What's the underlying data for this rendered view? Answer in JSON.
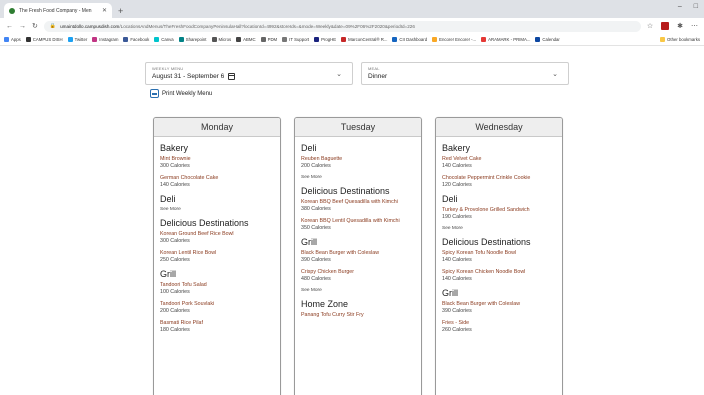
{
  "browser": {
    "tab_title": "The Fresh Food Company - Men",
    "url_host": "umaintdollo.campusdish.com",
    "url_path": "/LocationsAndMenus/TheFreshFoodCompanyPeninsulaHall?locationId=4992&storeIds=&mode=Weekly&date=09%2F06%2F2020&periodId=226",
    "bookmarks": [
      "Apps",
      "CAMPUS DISH",
      "Twitter",
      "Instagram",
      "Facebook",
      "Canva",
      "Sharepoint",
      "Micros",
      "ABMC",
      "PDM",
      "IT Support",
      "ProgHE",
      "MarconCentral® R...",
      "CII Dashboard",
      "Encore! Encore! -...",
      "ARAMARK - PRIMA...",
      "Calendar"
    ],
    "other_bookmarks": "Other bookmarks"
  },
  "filters": {
    "week_label": "WEEKLY MENU",
    "week_value": "August 31 - September 6",
    "meal_label": "MEAL",
    "meal_value": "Dinner",
    "print_label": "Print Weekly Menu"
  },
  "days": [
    {
      "name": "Monday",
      "stations": [
        {
          "name": "Bakery",
          "items": [
            {
              "name": "Mint Brownie",
              "calories": "300 Calories"
            },
            {
              "name": "German Chocolate Cake",
              "calories": "140 Calories"
            }
          ],
          "see_more": ""
        },
        {
          "name": "Deli",
          "items": [],
          "see_more": "See More"
        },
        {
          "name": "Delicious Destinations",
          "items": [
            {
              "name": "Korean Ground Beef Rice Bowl",
              "calories": "300 Calories"
            },
            {
              "name": "Korean Lentil Rice Bowl",
              "calories": "250 Calories"
            }
          ],
          "see_more": ""
        },
        {
          "name": "Grill",
          "items": [
            {
              "name": "Tandoori Tofu Salad",
              "calories": "100 Calories"
            },
            {
              "name": "Tandoori Pork Souvlaki",
              "calories": "200 Calories"
            },
            {
              "name": "Basmati Rice Pilaf",
              "calories": "180 Calories"
            }
          ],
          "see_more": ""
        }
      ]
    },
    {
      "name": "Tuesday",
      "stations": [
        {
          "name": "Deli",
          "items": [
            {
              "name": "Reuben Baguette",
              "calories": "200 Calories"
            }
          ],
          "see_more": "See More"
        },
        {
          "name": "Delicious Destinations",
          "items": [
            {
              "name": "Korean BBQ Beef Quesadilla with Kimchi",
              "calories": "380 Calories"
            },
            {
              "name": "Korean BBQ Lentil Quesadilla with Kimchi",
              "calories": "350 Calories"
            }
          ],
          "see_more": ""
        },
        {
          "name": "Grill",
          "items": [
            {
              "name": "Black Bean Burger with Coleslaw",
              "calories": "390 Calories"
            },
            {
              "name": "Crispy Chicken Burger",
              "calories": "480 Calories"
            }
          ],
          "see_more": "See More"
        },
        {
          "name": "Home Zone",
          "items": [
            {
              "name": "Panang Tofu Curry Stir Fry",
              "calories": ""
            }
          ],
          "see_more": ""
        }
      ]
    },
    {
      "name": "Wednesday",
      "stations": [
        {
          "name": "Bakery",
          "items": [
            {
              "name": "Red Velvet Cake",
              "calories": "140 Calories"
            },
            {
              "name": "Chocolate Peppermint Crinkle Cookie",
              "calories": "120 Calories"
            }
          ],
          "see_more": ""
        },
        {
          "name": "Deli",
          "items": [
            {
              "name": "Turkey & Provolone Grilled Sandwich",
              "calories": "190 Calories"
            }
          ],
          "see_more": "See More"
        },
        {
          "name": "Delicious Destinations",
          "items": [
            {
              "name": "Spicy Korean Tofu Noodle Bowl",
              "calories": "140 Calories"
            },
            {
              "name": "Spicy Korean Chicken Noodle Bowl",
              "calories": "140 Calories"
            }
          ],
          "see_more": ""
        },
        {
          "name": "Grill",
          "items": [
            {
              "name": "Black Bean Burger with Coleslaw",
              "calories": "390 Calories"
            },
            {
              "name": "Fries - Side",
              "calories": "260 Calories"
            }
          ],
          "see_more": ""
        }
      ]
    }
  ],
  "colors": {
    "item_name": "#8a3a1e",
    "header_bg": "#eeeeee",
    "card_border": "#9a9a9a"
  }
}
